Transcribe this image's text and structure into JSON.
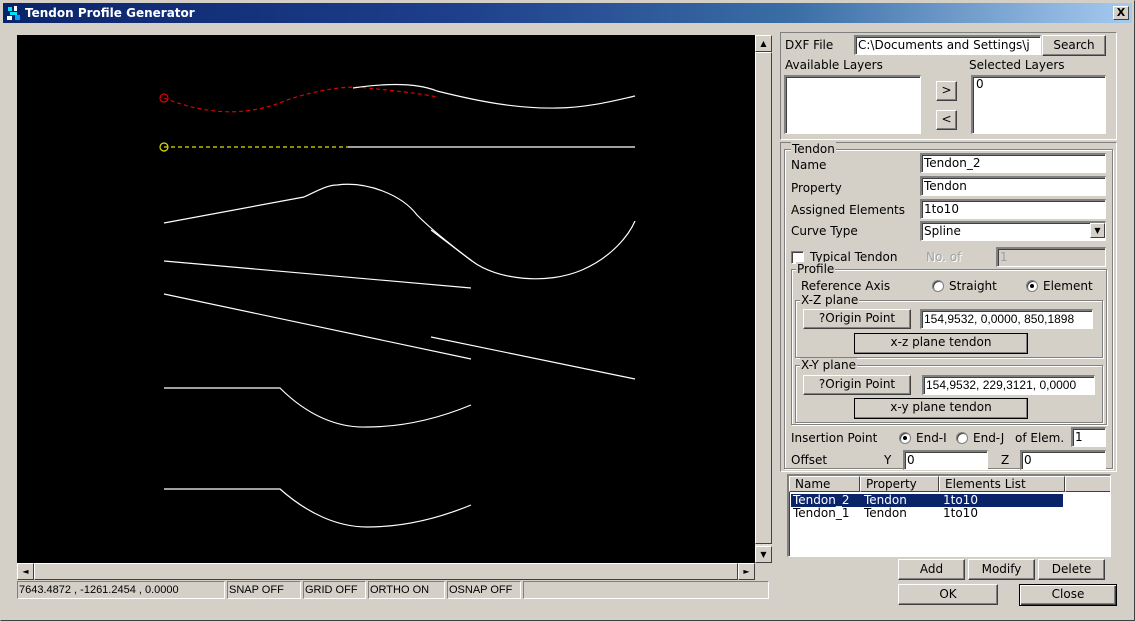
{
  "window": {
    "title": "Tendon Profile Generator",
    "close_label": "X"
  },
  "canvas": {
    "scroll_up": "▲",
    "scroll_down": "▼",
    "scroll_left": "◄",
    "scroll_right": "►"
  },
  "status_bar": {
    "coordinates": "7643.4872 , -1261.2454 , 0.0000",
    "snap": "SNAP OFF",
    "grid": "GRID OFF",
    "ortho": "ORTHO ON",
    "osnap": "OSNAP OFF",
    "extra": ""
  },
  "dxf": {
    "label": "DXF File",
    "path": "C:\\Documents and Settings\\j",
    "search_label": "Search",
    "available_layers_label": "Available Layers",
    "selected_layers_label": "Selected Layers",
    "available_layers": [],
    "selected_layers": [
      "0"
    ],
    "add_layer_label": ">",
    "remove_layer_label": "<"
  },
  "tendon": {
    "group_label": "Tendon",
    "name_label": "Name",
    "name_value": "Tendon_2",
    "property_label": "Property",
    "property_value": "Tendon",
    "assigned_label": "Assigned Elements",
    "assigned_value": "1to10",
    "curve_type_label": "Curve Type",
    "curve_type_value": "Spline",
    "typical_label": "Typical Tendon",
    "typical_checked": false,
    "no_of_label": "No. of",
    "no_of_value": "1"
  },
  "profile": {
    "group_label": "Profile",
    "ref_axis_label": "Reference Axis",
    "straight_label": "Straight",
    "element_label": "Element",
    "ref_axis_selected": "Element",
    "xz": {
      "group_label": "X-Z plane",
      "origin_button": "?Origin Point",
      "origin_value": "154,9532, 0,0000, 850,1898",
      "tendon_button": "x-z plane tendon"
    },
    "xy": {
      "group_label": "X-Y plane",
      "origin_button": "?Origin Point",
      "origin_value": "154,9532, 229,3121, 0,0000",
      "tendon_button": "x-y plane tendon"
    }
  },
  "insertion": {
    "label": "Insertion Point",
    "end_i_label": "End-I",
    "end_j_label": "End-J",
    "selected": "End-I",
    "of_elem_label": "of Elem.",
    "elem_value": "1",
    "offset_label": "Offset",
    "y_label": "Y",
    "y_value": "0",
    "z_label": "Z",
    "z_value": "0"
  },
  "tendon_list": {
    "columns": [
      "Name",
      "Property",
      "Elements List",
      ""
    ],
    "rows": [
      {
        "name": "Tendon_2",
        "property": "Tendon",
        "elements": "1to10",
        "selected": true
      },
      {
        "name": "Tendon_1",
        "property": "Tendon",
        "elements": "1to10",
        "selected": false
      }
    ]
  },
  "actions": {
    "add": "Add",
    "modify": "Modify",
    "delete": "Delete",
    "ok": "OK",
    "close": "Close"
  },
  "colors": {
    "canvas_bg": "#000000",
    "curve": "#ffffff",
    "selected_curve": "#e00000",
    "selected_line": "#e0e000",
    "title_bar": "#0a246a",
    "selection": "#0a246a"
  }
}
